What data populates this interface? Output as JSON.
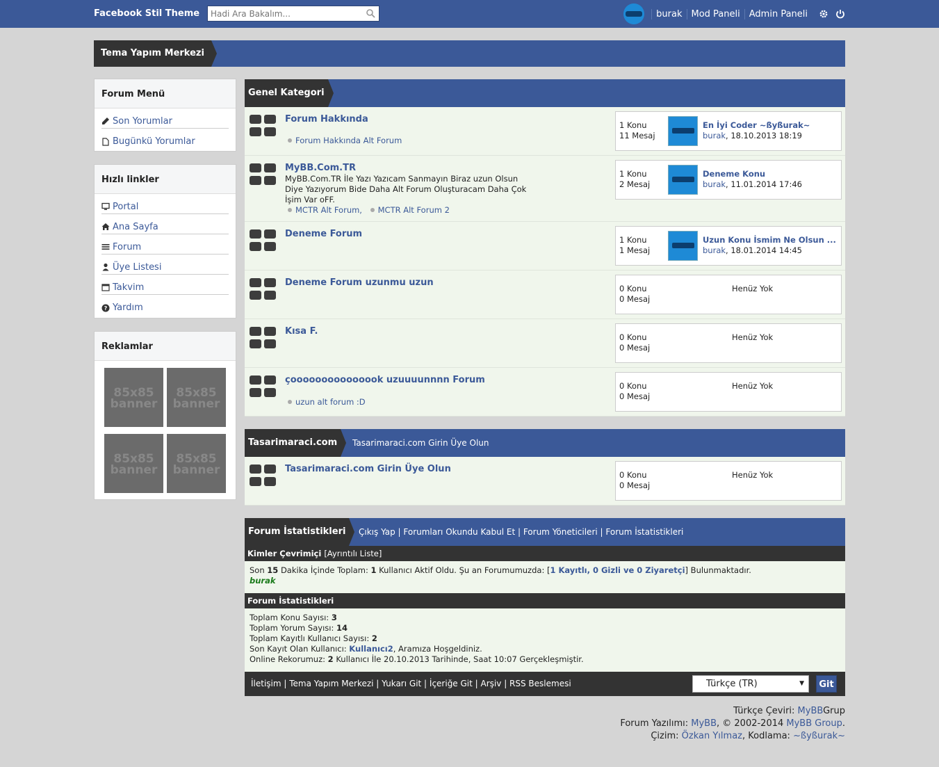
{
  "topbar": {
    "brand": "Facebook Stil Theme",
    "search_placeholder": "Hadi Ara Bakalım...",
    "user": "burak",
    "mod_panel": "Mod Paneli",
    "admin_panel": "Admin Paneli"
  },
  "header": {
    "title": "Tema Yapım Merkezi"
  },
  "sidebar": {
    "forum_menu": {
      "title": "Forum Menü",
      "items": [
        "Son Yorumlar",
        "Bugünkü Yorumlar"
      ]
    },
    "quick_links": {
      "title": "Hızlı linkler",
      "items": [
        "Portal",
        "Ana Sayfa",
        "Forum",
        "Üye Listesi",
        "Takvim",
        "Yardım"
      ]
    },
    "ads": {
      "title": "Reklamlar",
      "banner_line1": "85x85",
      "banner_line2": "banner"
    }
  },
  "categories": [
    {
      "name": "Genel Kategori",
      "description": "",
      "forums": [
        {
          "title": "Forum Hakkında",
          "description": "",
          "subforums": [
            "Forum Hakkında Alt Forum"
          ],
          "threads": "1 Konu",
          "posts": "11 Mesaj",
          "last_title": "En İyi Coder ~ßyßurak~",
          "last_user": "burak",
          "last_date": ", 18.10.2013 18:19"
        },
        {
          "title": "MyBB.Com.TR",
          "description": "MyBB.Com.TR İle Yazı Yazıcam Sanmayın Biraz uzun Olsun Diye Yazıyorum Bide Daha Alt Forum Oluşturacam Daha Çok İşim Var oFF.",
          "subforums": [
            "MCTR Alt Forum,",
            "MCTR Alt Forum 2"
          ],
          "threads": "1 Konu",
          "posts": "2 Mesaj",
          "last_title": "Deneme Konu",
          "last_user": "burak",
          "last_date": ", 11.01.2014 17:46"
        },
        {
          "title": "Deneme Forum",
          "description": "",
          "subforums": [],
          "threads": "1 Konu",
          "posts": "1 Mesaj",
          "last_title": "Uzun Konu İsmim Ne Olsun ...",
          "last_user": "burak",
          "last_date": ", 18.01.2014 14:45"
        },
        {
          "title": "Deneme Forum uzunmu uzun",
          "description": "",
          "subforums": [],
          "threads": "0 Konu",
          "posts": "0 Mesaj",
          "none": "Henüz Yok"
        },
        {
          "title": "Kısa F.",
          "description": "",
          "subforums": [],
          "threads": "0 Konu",
          "posts": "0 Mesaj",
          "none": "Henüz Yok"
        },
        {
          "title": "çooooooooooooook uzuuuunnnn Forum",
          "description": "",
          "subforums": [
            "uzun alt forum :D"
          ],
          "threads": "0 Konu",
          "posts": "0 Mesaj",
          "none": "Henüz Yok"
        }
      ]
    },
    {
      "name": "Tasarimaraci.com",
      "description": "Tasarimaraci.com Girin Üye Olun",
      "forums": [
        {
          "title": "Tasarimaraci.com Girin Üye Olun",
          "description": "",
          "subforums": [],
          "threads": "0 Konu",
          "posts": "0 Mesaj",
          "none": "Henüz Yok"
        }
      ]
    }
  ],
  "stats": {
    "title": "Forum İstatistikleri",
    "links": [
      "Çıkış Yap",
      "Forumları Okundu Kabul Et",
      "Forum Yöneticileri",
      "Forum İstatistikleri"
    ],
    "online_head": "Kimler Çevrimiçi",
    "online_detail": "[Ayrıntılı Liste]",
    "online_p1": "Son ",
    "online_minutes": "15",
    "online_p2": " Dakika İçinde Toplam: ",
    "online_total": "1",
    "online_p3": " Kullanıcı Aktif Oldu. Şu an Forumumuzda: [",
    "online_breakdown": "1 Kayıtlı, 0 Gizli ve 0 Ziyaretçi",
    "online_p4": "] Bulunmaktadır.",
    "online_user": "burak",
    "stats_head": "Forum İstatistikleri",
    "threads_label": "Toplam Konu Sayısı: ",
    "threads_value": "3",
    "posts_label": "Toplam Yorum Sayısı: ",
    "posts_value": "14",
    "members_label": "Toplam Kayıtlı Kullanıcı Sayısı: ",
    "members_value": "2",
    "newest_label": "Son Kayıt Olan Kullanıcı: ",
    "newest_value": "Kullanıcı2",
    "newest_suffix": ", Aramıza Hoşgeldiniz.",
    "record_label": "Online Rekorumuz: ",
    "record_value": "2",
    "record_suffix": " Kullanıcı İle 20.10.2013 Tarihinde, Saat 10:07 Gerçekleşmiştir."
  },
  "footer": {
    "links": [
      "İletişim",
      "Tema Yapım Merkezi",
      "Yukarı Git",
      "İçeriğe Git",
      "Arşiv",
      "RSS Beslemesi"
    ],
    "language": "Türkçe (TR)",
    "go": "Git",
    "credit1_label": "Türkçe Çeviri: ",
    "credit1_a": "MyBB",
    "credit1_b": "Grup",
    "credit2_label": "Forum Yazılımı: ",
    "credit2_a": "MyBB",
    "credit2_b": ", © 2002-2014 ",
    "credit2_c": "MyBB Group",
    "credit2_d": ".",
    "credit3_label": "Çizim: ",
    "credit3_a": "Özkan Yılmaz",
    "credit3_b": ", Kodlama: ",
    "credit3_c": "~ßyßurak~"
  },
  "colors": {
    "brand_blue": "#3b5998",
    "dark": "#333333",
    "row_bg": "#f0f6ec",
    "page_bg": "#d5d5d5"
  },
  "icons": {
    "search": "magnifier-icon",
    "settings": "gear-icon",
    "logout": "power-icon"
  }
}
